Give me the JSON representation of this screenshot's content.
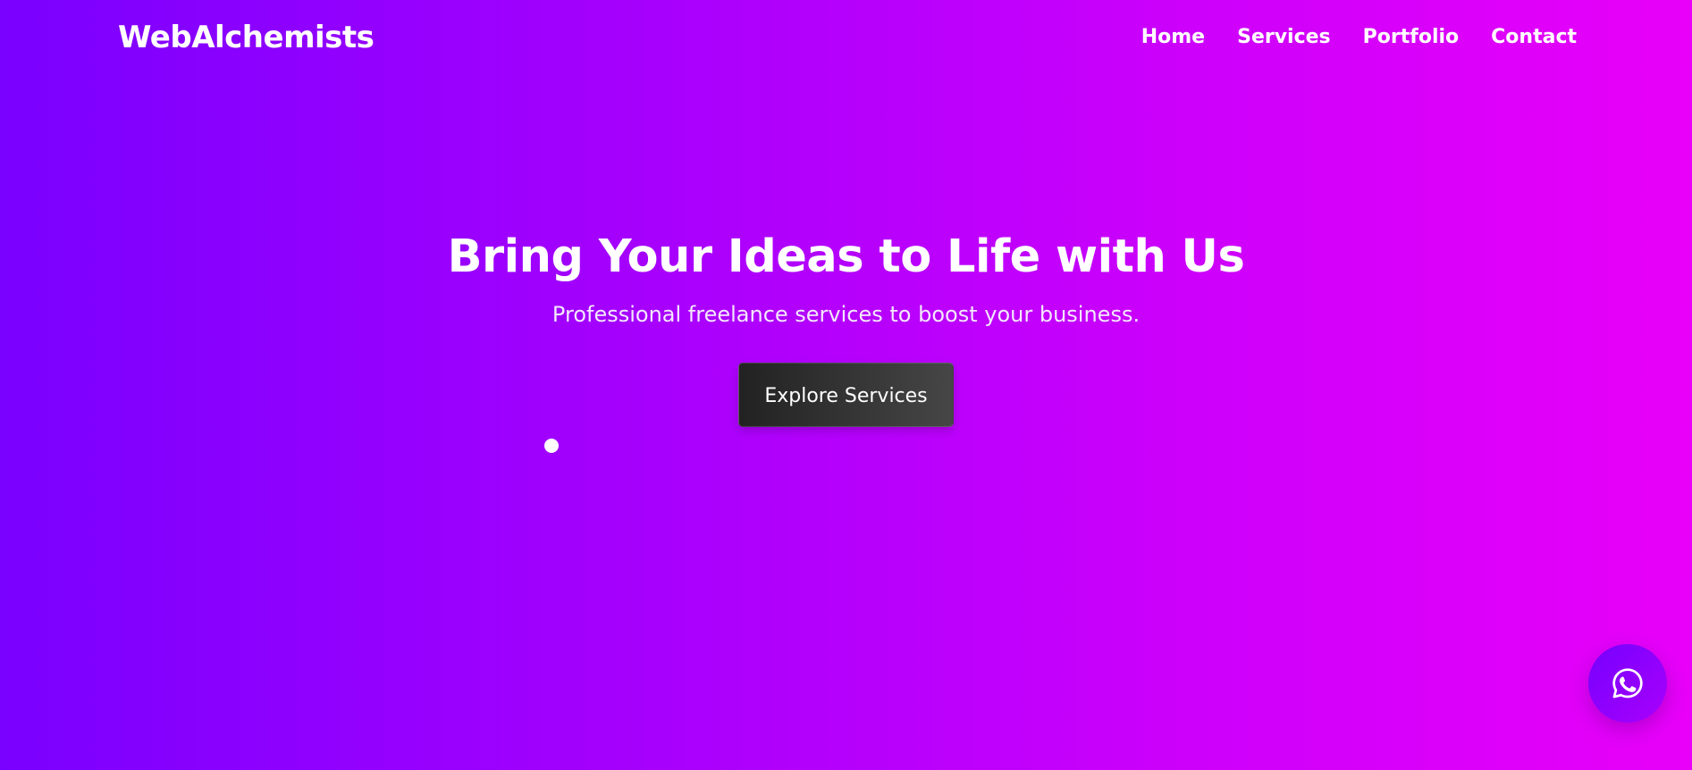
{
  "header": {
    "logo": "WebAlchemists",
    "nav": [
      {
        "label": "Home"
      },
      {
        "label": "Services"
      },
      {
        "label": "Portfolio"
      },
      {
        "label": "Contact"
      }
    ]
  },
  "hero": {
    "title": "Bring Your Ideas to Life with Us",
    "subtitle": "Professional freelance services to boost your business.",
    "cta_label": "Explore Services"
  },
  "floating_button": {
    "icon": "whatsapp-icon"
  },
  "colors": {
    "gradient_start": "#7a00ff",
    "gradient_end": "#e800f9",
    "button_dark": "#2b2b2b",
    "text": "#ffffff"
  }
}
